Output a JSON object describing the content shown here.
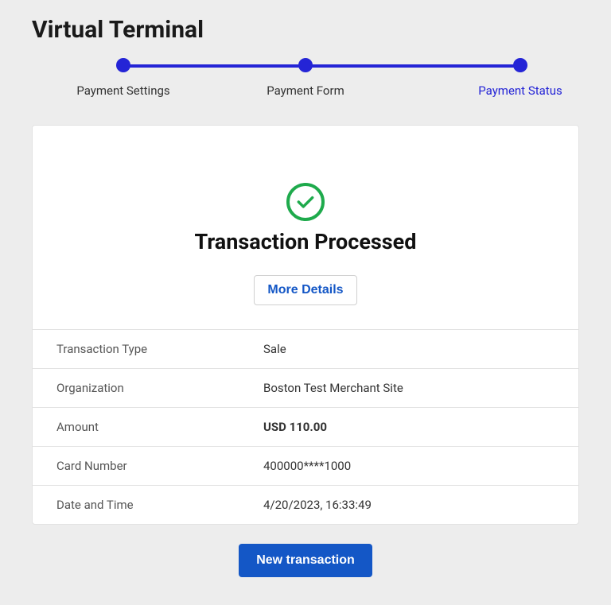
{
  "title": "Virtual Terminal",
  "steps": [
    {
      "label": "Payment Settings",
      "active": false
    },
    {
      "label": "Payment Form",
      "active": false
    },
    {
      "label": "Payment Status",
      "active": true
    }
  ],
  "status": {
    "heading": "Transaction Processed",
    "more_details_label": "More Details",
    "icon_color": "#1eaa4c"
  },
  "details": [
    {
      "label": "Transaction Type",
      "value": "Sale",
      "bold": false
    },
    {
      "label": "Organization",
      "value": "Boston Test Merchant Site",
      "bold": false
    },
    {
      "label": "Amount",
      "value": "USD 110.00",
      "bold": true
    },
    {
      "label": "Card Number",
      "value": "400000****1000",
      "bold": false
    },
    {
      "label": "Date and Time",
      "value": "4/20/2023, 16:33:49",
      "bold": false
    }
  ],
  "footer": {
    "new_transaction_label": "New transaction"
  }
}
